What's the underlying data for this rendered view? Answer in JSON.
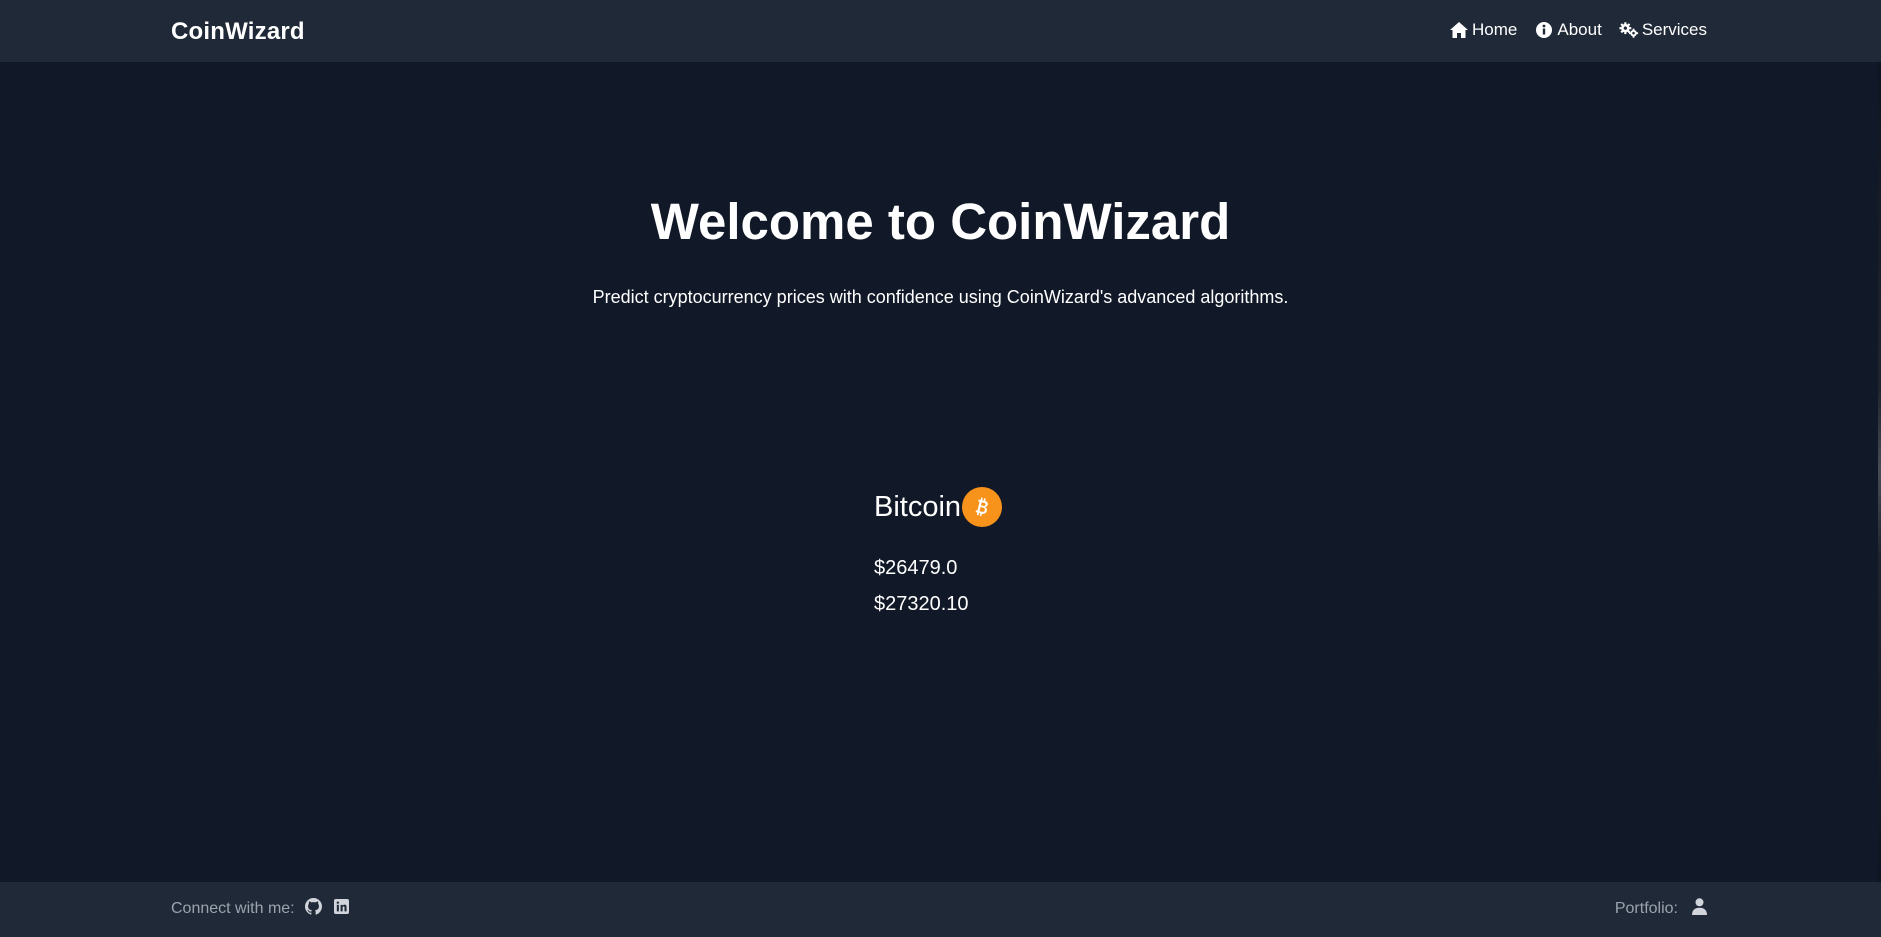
{
  "header": {
    "brand": "CoinWizard",
    "nav": [
      {
        "label": "Home",
        "icon": "home-icon"
      },
      {
        "label": "About",
        "icon": "info-icon"
      },
      {
        "label": "Services",
        "icon": "gears-icon"
      }
    ]
  },
  "hero": {
    "title": "Welcome to CoinWizard",
    "subtitle": "Predict cryptocurrency prices with confidence using CoinWizard's advanced algorithms."
  },
  "coin": {
    "name": "Bitcoin",
    "icon": "bitcoin-icon",
    "prices": [
      "$26479.0",
      "$27320.10"
    ]
  },
  "footer": {
    "connect_label": "Connect with me:",
    "social": [
      {
        "icon": "github-icon"
      },
      {
        "icon": "linkedin-icon"
      }
    ],
    "portfolio_label": "Portfolio:",
    "portfolio_icon": "user-icon"
  },
  "colors": {
    "background": "#111827",
    "bar": "#1f2937",
    "text": "#ffffff",
    "muted": "#9ca3af",
    "bitcoin": "#f7931a"
  }
}
